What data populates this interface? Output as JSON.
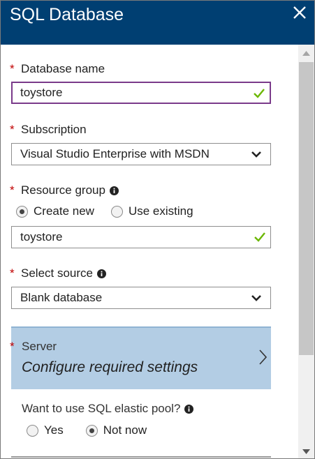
{
  "header": {
    "title": "SQL Database"
  },
  "database_name": {
    "label": "Database name",
    "value": "toystore"
  },
  "subscription": {
    "label": "Subscription",
    "selected": "Visual Studio Enterprise with MSDN"
  },
  "resource_group": {
    "label": "Resource group",
    "options": [
      "Create new",
      "Use existing"
    ],
    "selected_option": "Create new",
    "value": "toystore"
  },
  "select_source": {
    "label": "Select source",
    "selected": "Blank database"
  },
  "server": {
    "label": "Server",
    "value": "Configure required settings"
  },
  "elastic_pool": {
    "label": "Want to use SQL elastic pool?",
    "options": [
      "Yes",
      "Not now"
    ],
    "selected_option": "Not now"
  },
  "required_marker": "*",
  "colors": {
    "header_bg": "#003f72",
    "required": "#c00000",
    "valid_check": "#6bb700",
    "focus_border": "#7a3a8a",
    "server_blade_bg": "#b3cde4"
  }
}
